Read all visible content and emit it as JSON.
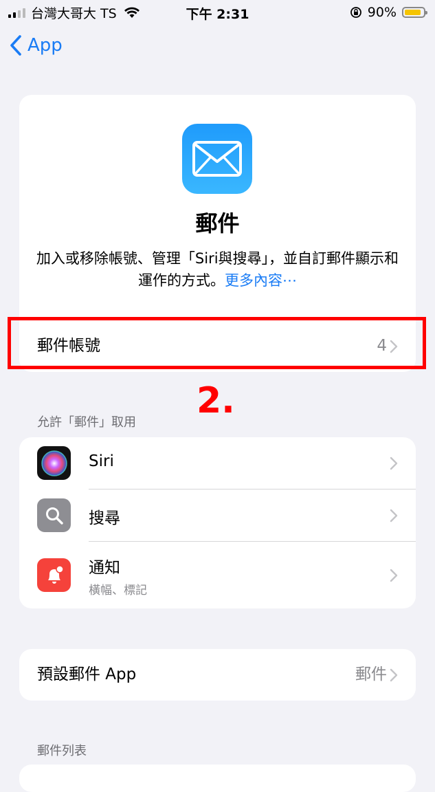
{
  "status_bar": {
    "carrier": "台灣大哥大 TS",
    "time": "下午 2:31",
    "battery_percent": "90%",
    "battery_level": 0.9,
    "battery_color": "#f5c400"
  },
  "nav": {
    "back_label": "App",
    "back_icon": "chevron-left-icon"
  },
  "hero": {
    "icon": "mail-envelope-icon",
    "title": "郵件",
    "description": "加入或移除帳號、管理「Siri與搜尋」，並自訂郵件顯示和運作的方式。",
    "more_link": "更多內容⋯",
    "row": {
      "label": "郵件帳號",
      "value": "4"
    }
  },
  "annotation": {
    "text": "2.",
    "color": "#ff0000"
  },
  "access_section": {
    "header": "允許「郵件」取用",
    "items": [
      {
        "title": "Siri",
        "subtitle": "",
        "icon": "siri-icon"
      },
      {
        "title": "搜尋",
        "subtitle": "",
        "icon": "search-icon"
      },
      {
        "title": "通知",
        "subtitle": "橫幅、標記",
        "icon": "notification-bell-icon"
      }
    ]
  },
  "default_app": {
    "label": "預設郵件 App",
    "value": "郵件"
  },
  "mail_list_section": {
    "header": "郵件列表"
  },
  "colors": {
    "accent": "#1a7cf5",
    "background": "#f2f2f7"
  }
}
